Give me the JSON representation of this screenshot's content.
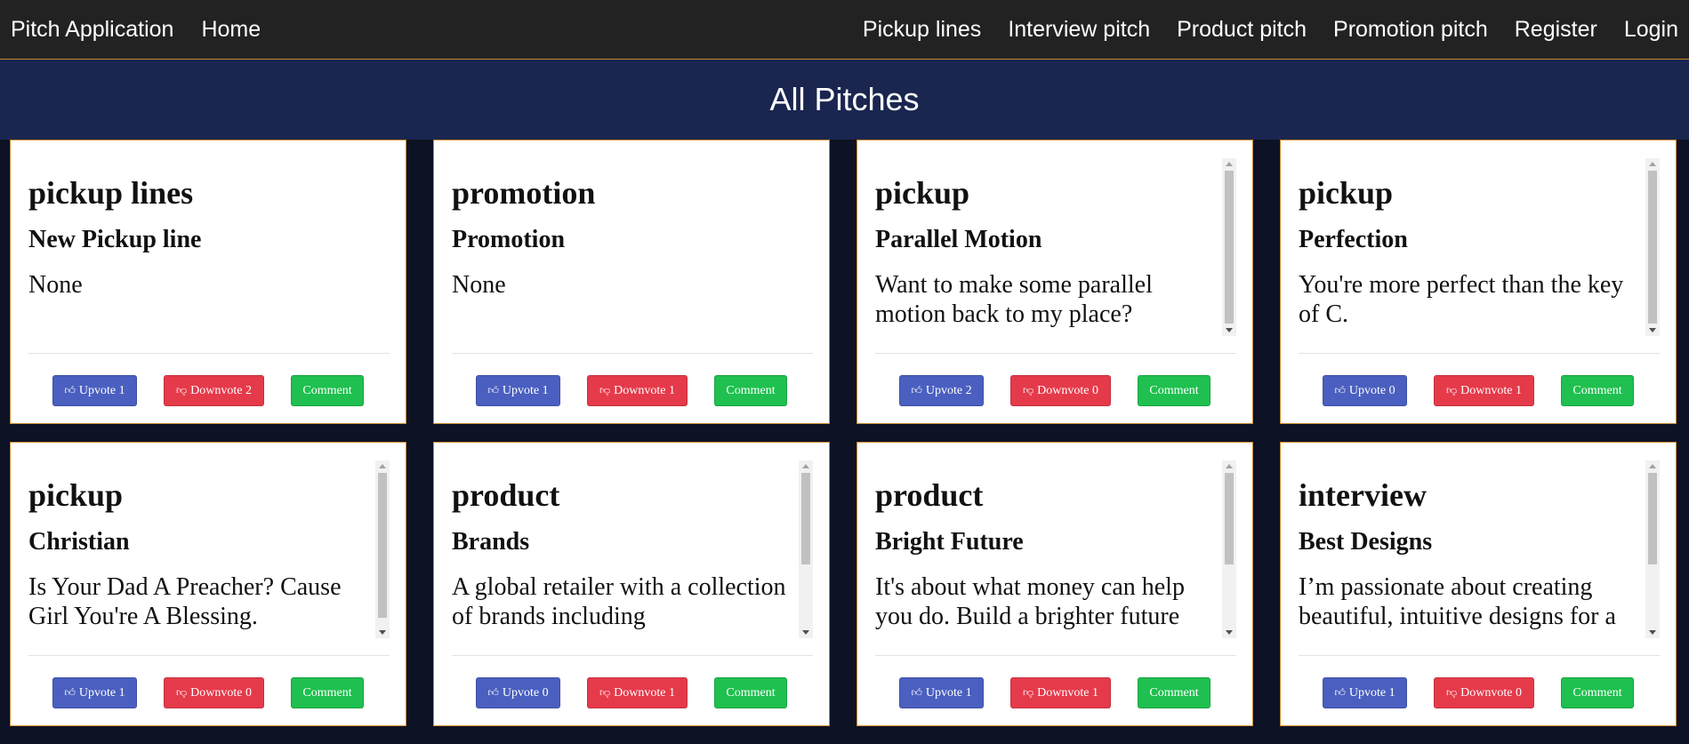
{
  "nav": {
    "brand": "Pitch Application",
    "home": "Home",
    "links": [
      "Pickup lines",
      "Interview pitch",
      "Product pitch",
      "Promotion pitch",
      "Register",
      "Login"
    ]
  },
  "banner": {
    "title": "All Pitches"
  },
  "buttons": {
    "upvote": "Upvote",
    "downvote": "Downvote",
    "comment": "Comment"
  },
  "icons": {
    "upvote": "thumbs-up-icon",
    "downvote": "thumbs-down-icon"
  },
  "pitches": [
    {
      "category": "pickup lines",
      "title": "New Pickup line",
      "description": "None",
      "upvotes": "1",
      "downvotes": "2",
      "scroll_thumb": null
    },
    {
      "category": "promotion",
      "title": "Promotion",
      "description": "None",
      "upvotes": "1",
      "downvotes": "1",
      "scroll_thumb": null
    },
    {
      "category": "pickup",
      "title": "Parallel Motion",
      "description": "Want to make some parallel motion back to my place?",
      "upvotes": "2",
      "downvotes": "0",
      "scroll_thumb": [
        0,
        1
      ]
    },
    {
      "category": "pickup",
      "title": "Perfection",
      "description": "You're more perfect than the key of C.",
      "upvotes": "0",
      "downvotes": "1",
      "scroll_thumb": [
        0,
        1
      ]
    },
    {
      "category": "pickup",
      "title": "Christian",
      "description": "Is Your Dad A Preacher? Cause Girl You're A Blessing.",
      "upvotes": "1",
      "downvotes": "0",
      "scroll_thumb": [
        0,
        0.95
      ]
    },
    {
      "category": "product",
      "title": "Brands",
      "description": "A global retailer with a collection of brands including",
      "upvotes": "0",
      "downvotes": "1",
      "scroll_thumb": [
        0,
        0.6
      ]
    },
    {
      "category": "product",
      "title": "Bright Future",
      "description": "It's about what money can help you do. Build a brighter future",
      "upvotes": "1",
      "downvotes": "1",
      "scroll_thumb": [
        0,
        0.6
      ]
    },
    {
      "category": "interview",
      "title": "Best Designs",
      "description": "I’m passionate about creating beautiful, intuitive designs for a",
      "upvotes": "1",
      "downvotes": "0",
      "scroll_thumb": [
        0,
        0.6
      ]
    }
  ]
}
